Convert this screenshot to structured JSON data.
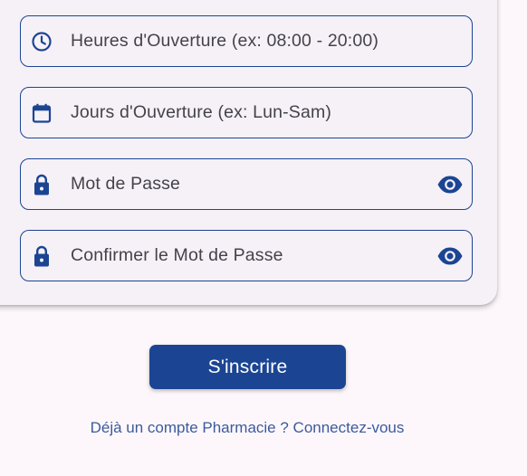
{
  "form": {
    "fields": [
      {
        "icon": "clock-icon",
        "label": "Heures d'Ouverture (ex: 08:00 - 20:00)"
      },
      {
        "icon": "calendar-icon",
        "label": "Jours d'Ouverture (ex: Lun-Sam)"
      },
      {
        "icon": "lock-icon",
        "label": "Mot de Passe",
        "trailing_icon": "eye-icon"
      },
      {
        "icon": "lock-icon",
        "label": "Confirmer le Mot de Passe",
        "trailing_icon": "eye-icon"
      }
    ],
    "submit_label": "S'inscrire",
    "login_link": "Déjà un compte Pharmacie ? Connectez-vous"
  },
  "colors": {
    "primary": "#1b4593",
    "background": "#fdf7fb",
    "card": "#f6f1f7",
    "field_text": "#44424a",
    "link": "#3b5b9c"
  }
}
